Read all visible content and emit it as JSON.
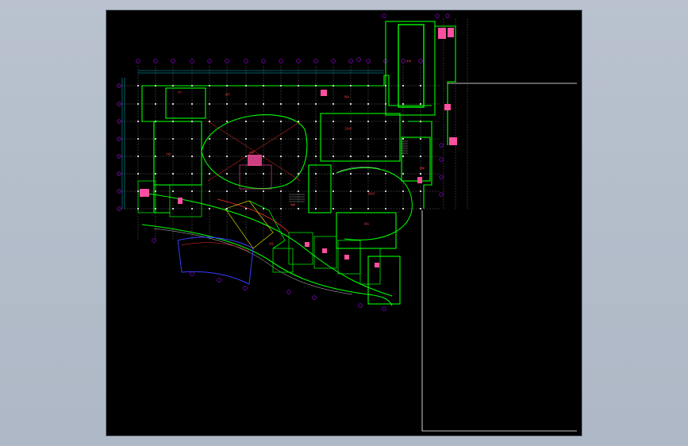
{
  "drawing": {
    "background": "#000000",
    "colors": {
      "wall": "#00ff00",
      "grid": "#9a9a9a",
      "axis_bubble": "#b000ff",
      "text": "#ff3030",
      "fixture": "#ff4fa0",
      "facade": "#3a3aff",
      "frame": "#ffffff",
      "dim": "#00ffff"
    },
    "column_axes": [
      "1",
      "2",
      "3",
      "4",
      "5",
      "6",
      "7",
      "8",
      "9",
      "10",
      "11",
      "12",
      "13",
      "14",
      "15",
      "16",
      "17"
    ],
    "row_axes": [
      "A",
      "B",
      "C",
      "D",
      "E",
      "F",
      "G",
      "H",
      "J"
    ],
    "room_labels": {
      "atrium": "中庭",
      "lobby": "大堂",
      "restaurant": "餐厅",
      "kitchen": "厨房",
      "office": "办公",
      "pool": "泳池",
      "wc": "卫生间",
      "stair": "楼梯",
      "lift": "电梯",
      "shop": "商店",
      "hall": "宴会厅",
      "store": "库房"
    }
  }
}
